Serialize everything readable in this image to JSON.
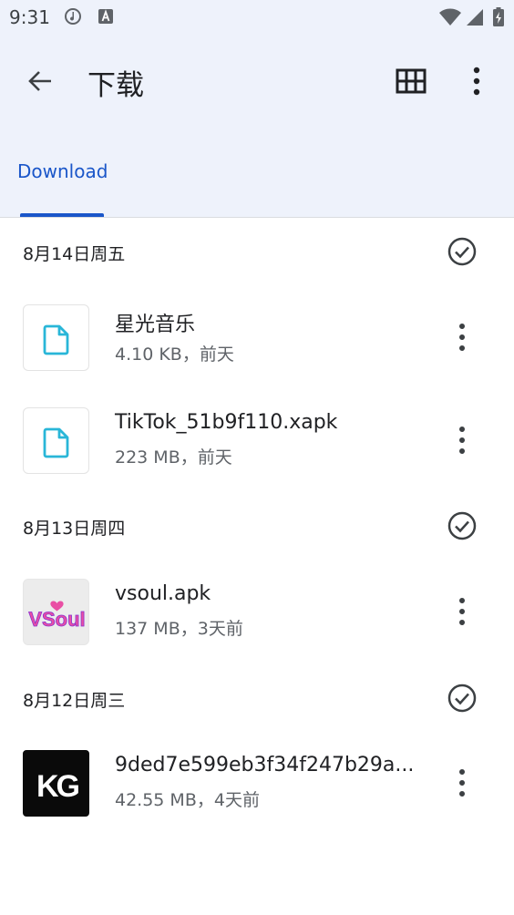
{
  "status_bar": {
    "time": "9:31",
    "icons": [
      "music-note-icon",
      "a-icon",
      "wifi-icon",
      "signal-icon",
      "battery-charging-icon"
    ]
  },
  "app_bar": {
    "title": "下载",
    "back_icon": "arrow-back-icon",
    "grid_icon": "grid-view-icon",
    "menu_icon": "more-vert-icon"
  },
  "tabs": [
    {
      "label": "Download",
      "selected": true
    }
  ],
  "colors": {
    "accent": "#1a56c9",
    "header_bg": "#eef2fb",
    "file_icon": "#29b6d8"
  },
  "sections": [
    {
      "date": "8月14日周五",
      "files": [
        {
          "name": "星光音乐",
          "meta": "4.10 KB，前天",
          "thumb": "document-icon"
        },
        {
          "name": "TikTok_51b9f110.xapk",
          "meta": "223 MB，前天",
          "thumb": "document-icon"
        }
      ]
    },
    {
      "date": "8月13日周四",
      "files": [
        {
          "name": "vsoul.apk",
          "meta": "137 MB，3天前",
          "thumb": "vsoul-logo",
          "logo_text": "VSoul"
        }
      ]
    },
    {
      "date": "8月12日周三",
      "files": [
        {
          "name": "9ded7e599eb3f34f247b29a...",
          "meta": "42.55 MB，4天前",
          "thumb": "kg-logo",
          "logo_text": "KG"
        }
      ]
    }
  ]
}
